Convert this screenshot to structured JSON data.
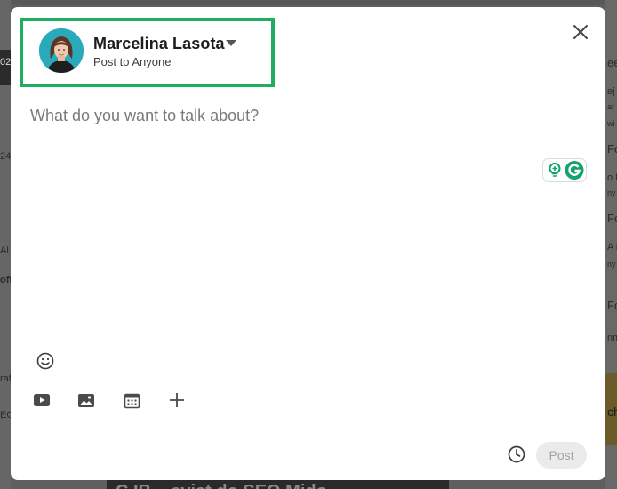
{
  "background": {
    "left_fragments": [
      "02",
      "24",
      "Al",
      "off",
      "raf",
      "EO"
    ],
    "right_fragments": [
      "ee",
      "ej",
      "ar",
      "wi",
      "Fo",
      "o M",
      "ny",
      "Fo",
      "A D",
      "ny",
      "Fo",
      "nm",
      "ch"
    ],
    "bottom_fragment": "C IB... evist do SEO Mido"
  },
  "modal": {
    "author": {
      "name": "Marcelina Lasota",
      "visibility": "Post to Anyone"
    },
    "editor": {
      "placeholder": "What do you want to talk about?"
    },
    "footer": {
      "post_label": "Post"
    },
    "icons": {
      "close": "close-icon",
      "dropdown": "caret-down-icon",
      "grammarly": "grammarly-icon",
      "emoji": "emoji-icon",
      "video": "video-icon",
      "photo": "photo-icon",
      "event": "calendar-icon",
      "more": "plus-icon",
      "schedule": "clock-icon"
    }
  },
  "colors": {
    "highlight_box": "#1fae5f",
    "grammarly_green": "#15a36b",
    "post_disabled_bg": "#ebebeb",
    "post_disabled_text": "#a4a4a4"
  }
}
